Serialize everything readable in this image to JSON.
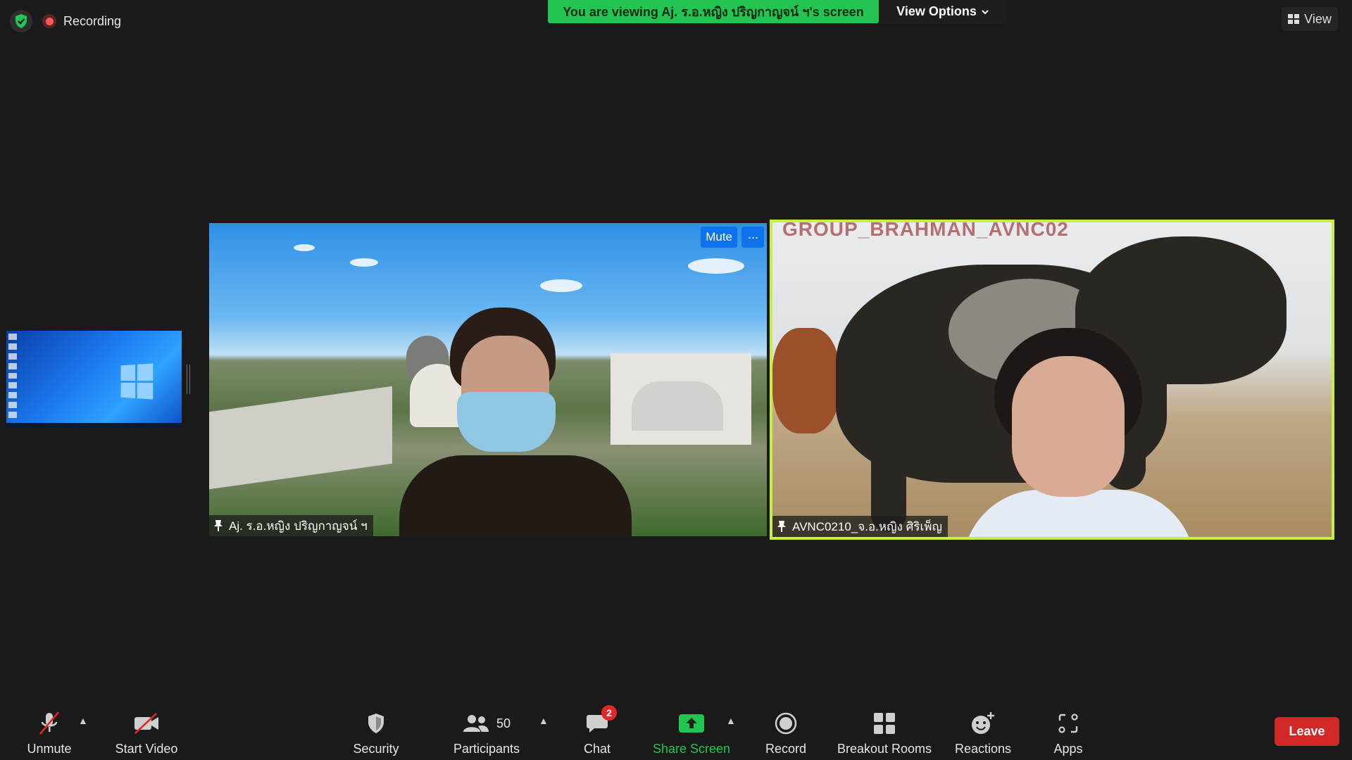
{
  "top": {
    "recording_label": "Recording",
    "viewing_banner": "You are viewing Aj. ร.อ.หญิง ปริญกาญจน์ ฯ's screen",
    "view_options_label": "View Options",
    "view_label": "View"
  },
  "tiles": [
    {
      "name": "Aj. ร.อ.หญิง ปริญกาญจน์ ฯ",
      "mute_label": "Mute",
      "more_label": "···"
    },
    {
      "name": "AVNC0210_จ.อ.หญิง ศิริเพ็ญ",
      "overlay_text": "GROUP_BRAHMAN_AVNC02"
    }
  ],
  "toolbar": {
    "unmute": "Unmute",
    "start_video": "Start Video",
    "security": "Security",
    "participants": "Participants",
    "participants_count": "50",
    "chat": "Chat",
    "chat_badge": "2",
    "share_screen": "Share Screen",
    "record": "Record",
    "breakout_rooms": "Breakout Rooms",
    "reactions": "Reactions",
    "apps": "Apps",
    "leave": "Leave"
  },
  "colors": {
    "banner_green": "#23c552",
    "active_speaker_border": "#c8ef3c",
    "mute_blue": "#0e72ed",
    "leave_red": "#d32828",
    "background": "#1a1a1a"
  },
  "icons": [
    "shield-check-icon",
    "record-dot-icon",
    "chevron-down-icon",
    "grid-view-icon",
    "pin-icon",
    "mic-off-icon",
    "video-off-icon",
    "caret-up-icon",
    "security-shield-icon",
    "participants-icon",
    "chat-icon",
    "share-screen-icon",
    "record-icon",
    "breakout-rooms-icon",
    "reactions-icon",
    "apps-icon"
  ]
}
